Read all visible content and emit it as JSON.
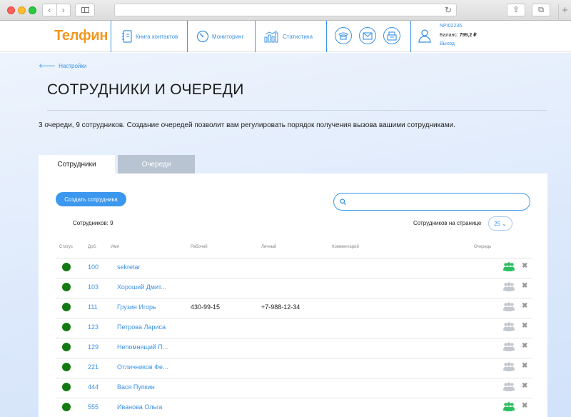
{
  "browser": {
    "back_glyph": "‹",
    "forward_glyph": "›",
    "reload_glyph": "↻",
    "share_glyph": "⇧",
    "tabs_glyph": "⧉",
    "newtab_glyph": "+"
  },
  "header": {
    "logo": "Телфин",
    "nav": [
      {
        "label": "Книга контактов",
        "icon": "address-book-icon"
      },
      {
        "label": "Мониторинг",
        "icon": "gauge-icon"
      },
      {
        "label": "Статистика",
        "icon": "bar-chart-icon"
      }
    ],
    "round_icons": [
      "phone-icon",
      "mail-icon",
      "fax-icon"
    ],
    "account": {
      "id": "NPI02235",
      "balance_label": "Баланс:",
      "balance_value": "799,2 ₽",
      "logout": "Выход"
    }
  },
  "page": {
    "back_link": "Настройки",
    "title": "СОТРУДНИКИ И ОЧЕРЕДИ",
    "description": "3 очереди, 9 сотрудников. Создание очередей позволит вам регулировать порядок получения вызова вашими сотрудниками.",
    "tabs": [
      {
        "label": "Сотрудники",
        "active": true
      },
      {
        "label": "Очереди",
        "active": false
      }
    ],
    "create_button": "Создать сотрудника",
    "search_placeholder": "",
    "count_label": "Сотрудников: 9",
    "per_page_label": "Сотрудников на странице",
    "per_page_value": "25",
    "per_page_chevron": "⌄",
    "columns": [
      "Статус",
      "Доб.",
      "Имя",
      "Рабочий",
      "Личный",
      "Комментарий",
      "Очередь"
    ],
    "delete_glyph": "✖",
    "employees": [
      {
        "ext": "100",
        "name": "sekretar",
        "work": "",
        "personal": "",
        "queue_active": true
      },
      {
        "ext": "103",
        "name": "Хороший Дмит...",
        "work": "",
        "personal": "",
        "queue_active": false
      },
      {
        "ext": "111",
        "name": "Грузин Игорь",
        "work": "430-99-15",
        "personal": "+7-988-12-34",
        "queue_active": false
      },
      {
        "ext": "123",
        "name": "Петрова Лариса",
        "work": "",
        "personal": "",
        "queue_active": false
      },
      {
        "ext": "129",
        "name": "Непомнящий П...",
        "work": "",
        "personal": "",
        "queue_active": false
      },
      {
        "ext": "221",
        "name": "Отличников Фе...",
        "work": "",
        "personal": "",
        "queue_active": false
      },
      {
        "ext": "444",
        "name": "Вася Пупкин",
        "work": "",
        "personal": "",
        "queue_active": false
      },
      {
        "ext": "555",
        "name": "Иванова Ольга",
        "work": "",
        "personal": "",
        "queue_active": true
      }
    ]
  },
  "colors": {
    "accent": "#3a92e6",
    "logo": "#f29722",
    "status_online": "#137a13",
    "queue_active": "#2bbf5e",
    "queue_inactive": "#c4c9d0"
  }
}
